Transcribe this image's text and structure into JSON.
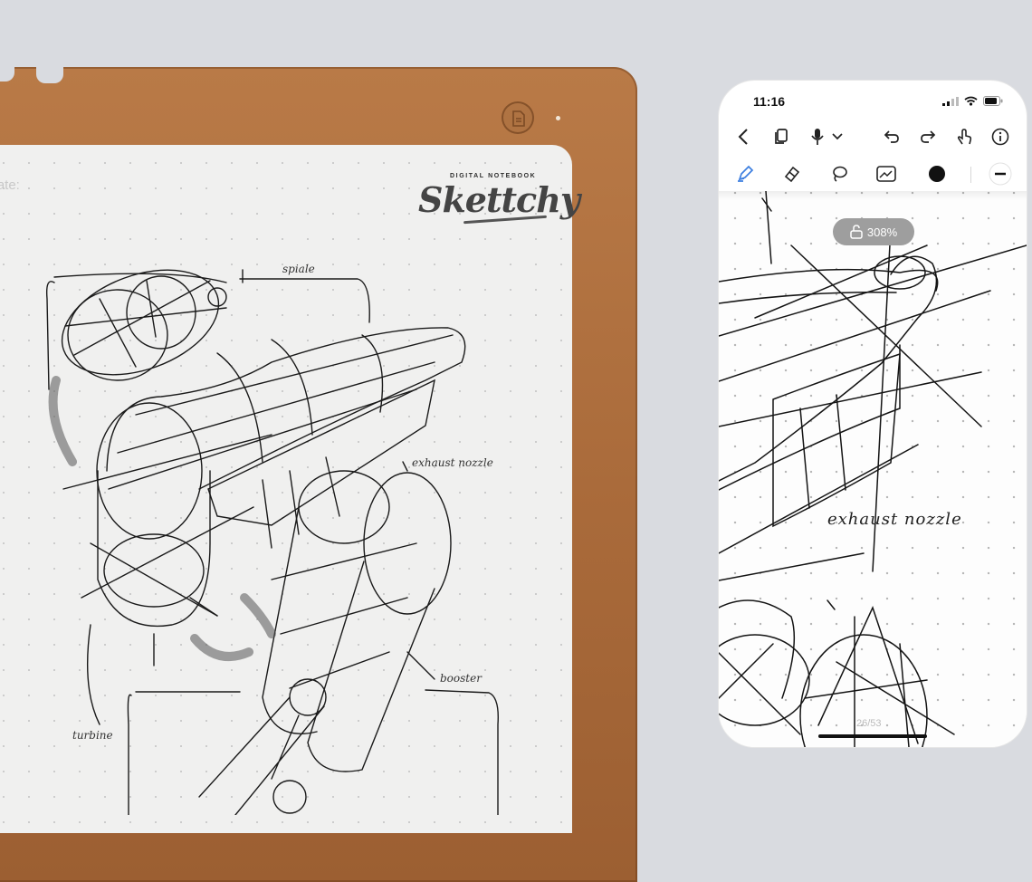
{
  "notebook": {
    "date_label": "Date:",
    "brand_tagline": "DIGITAL NOTEBOOK",
    "brand_name": "Skettchy",
    "sketch_labels": {
      "spiral": "spiale",
      "exhaust_nozzle": "exhaust nozzle",
      "booster": "booster",
      "turbine": "turbine"
    }
  },
  "phone": {
    "status_time": "11:16",
    "toolbar_top": [
      "back-icon",
      "pages-icon",
      "microphone-icon",
      "chevron-down-icon",
      "undo-icon",
      "redo-icon",
      "touch-icon",
      "info-icon"
    ],
    "toolbar_tools": [
      "pen-icon",
      "eraser-icon",
      "lasso-icon",
      "image-icon",
      "color-swatch",
      "stroke-width-icon"
    ],
    "zoom_level": "308%",
    "sketch_label": "exhaust nozzle",
    "page_indicator": "26/53",
    "accent_color": "#3d7fe0"
  }
}
